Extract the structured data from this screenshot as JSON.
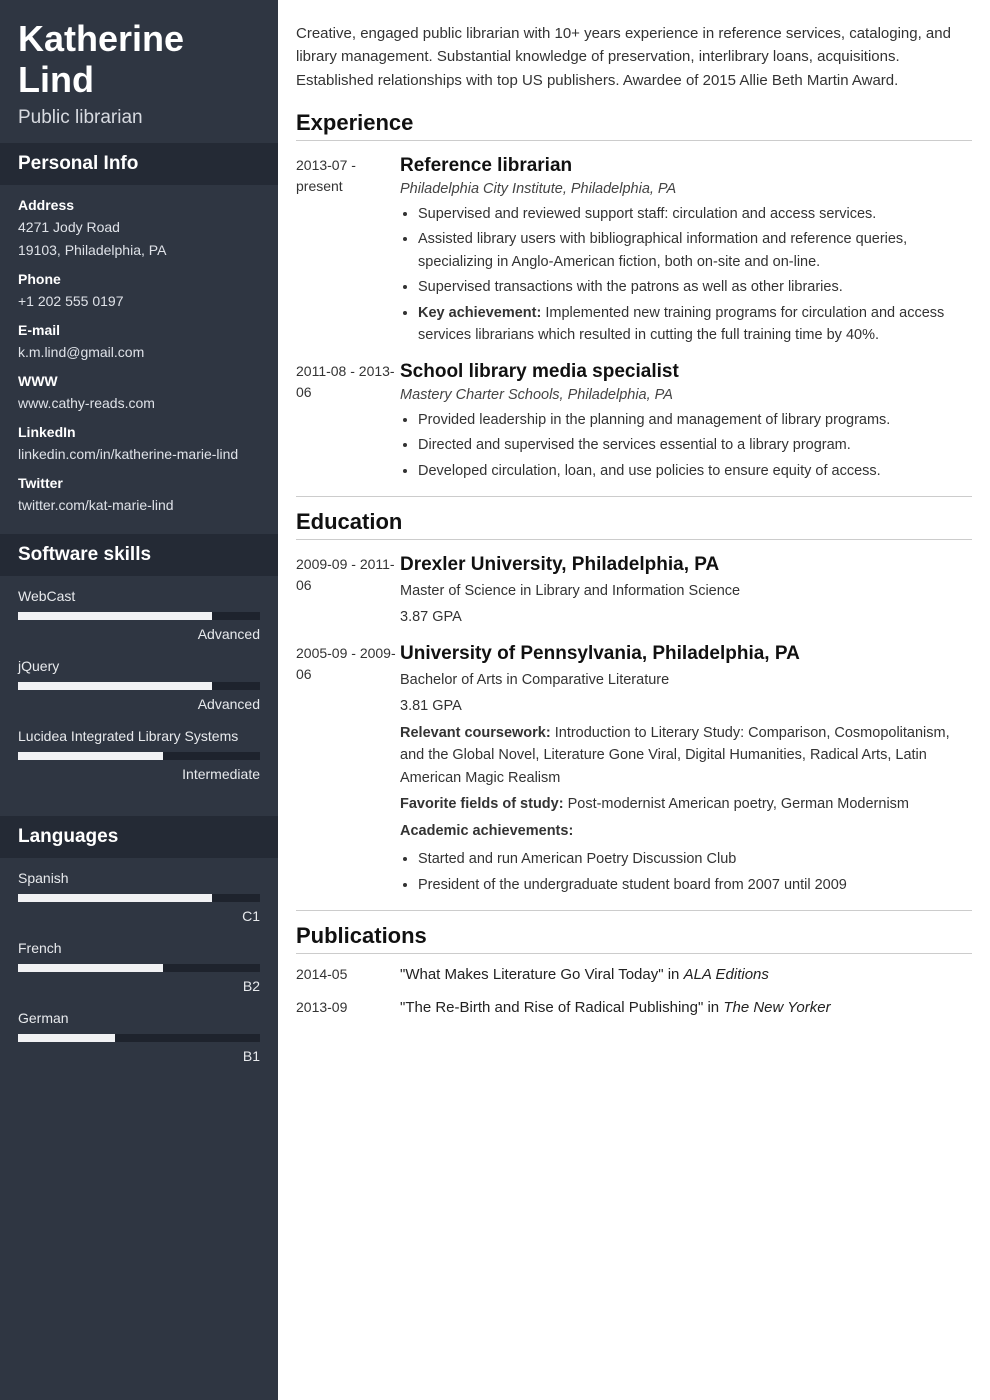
{
  "name": "Katherine Lind",
  "title": "Public librarian",
  "sidebar": {
    "personal_info_heading": "Personal Info",
    "info": {
      "address_label": "Address",
      "address_line1": "4271 Jody Road",
      "address_line2": "19103, Philadelphia, PA",
      "phone_label": "Phone",
      "phone_value": "+1 202 555 0197",
      "email_label": "E-mail",
      "email_value": "k.m.lind@gmail.com",
      "www_label": "WWW",
      "www_value": "www.cathy-reads.com",
      "linkedin_label": "LinkedIn",
      "linkedin_value": "linkedin.com/in/katherine-marie-lind",
      "twitter_label": "Twitter",
      "twitter_value": "twitter.com/kat-marie-lind"
    },
    "software_heading": "Software skills",
    "software": [
      {
        "name": "WebCast",
        "level": "Advanced",
        "pct": 80
      },
      {
        "name": "jQuery",
        "level": "Advanced",
        "pct": 80
      },
      {
        "name": "Lucidea Integrated Library Systems",
        "level": "Intermediate",
        "pct": 60
      }
    ],
    "languages_heading": "Languages",
    "languages": [
      {
        "name": "Spanish",
        "level": "C1",
        "pct": 80
      },
      {
        "name": "French",
        "level": "B2",
        "pct": 60
      },
      {
        "name": "German",
        "level": "B1",
        "pct": 40
      }
    ]
  },
  "summary": "Creative, engaged public librarian with 10+ years experience in reference services, cataloging, and library management. Substantial knowledge of preservation, interlibrary loans, acquisitions. Established relationships with top US publishers. Awardee of 2015 Allie Beth Martin Award.",
  "experience_heading": "Experience",
  "experience": [
    {
      "dates": "2013-07 - present",
      "title": "Reference librarian",
      "subtitle": "Philadelphia City Institute, Philadelphia, PA",
      "bullets": [
        "Supervised and reviewed support staff: circulation and access services.",
        "Assisted library users with bibliographical information and reference queries, specializing in Anglo-American fiction, both on-site and on-line.",
        "Supervised transactions with the patrons as well as other libraries."
      ],
      "key_label": "Key achievement:",
      "key_text": " Implemented new training programs for circulation and access services librarians which resulted in cutting the full training time by 40%."
    },
    {
      "dates": "2011-08 - 2013-06",
      "title": "School library media specialist",
      "subtitle": "Mastery Charter Schools, Philadelphia, PA",
      "bullets": [
        "Provided leadership in the planning and management of library programs.",
        "Directed and supervised the services essential to a library program.",
        "Developed circulation, loan, and use policies to ensure equity of access."
      ]
    }
  ],
  "education_heading": "Education",
  "education": [
    {
      "dates": "2009-09 - 2011-06",
      "title": "Drexler University, Philadelphia, PA",
      "degree": "Master of Science in Library and Information Science",
      "gpa": "3.87 GPA"
    },
    {
      "dates": "2005-09 - 2009-06",
      "title": "University of Pennsylvania, Philadelphia, PA",
      "degree": "Bachelor of Arts in Comparative Literature",
      "gpa": "3.81 GPA",
      "coursework_label": "Relevant coursework:",
      "coursework_text": " Introduction to Literary Study: Comparison, Cosmopolitanism, and the Global Novel, Literature Gone Viral, Digital Humanities, Radical Arts, Latin American Magic Realism",
      "favorites_label": "Favorite fields of study:",
      "favorites_text": " Post-modernist American poetry, German Modernism",
      "achievements_label": "Academic achievements:",
      "achievements": [
        "Started and run American Poetry Discussion Club",
        "President of the undergraduate student board from 2007 until 2009"
      ]
    }
  ],
  "publications_heading": "Publications",
  "publications": [
    {
      "date": "2014-05",
      "title": "\"What Makes Literature Go Viral Today\" in ",
      "venue": "ALA Editions"
    },
    {
      "date": "2013-09",
      "title": "\"The Re-Birth and Rise of Radical Publishing\" in ",
      "venue": "The New Yorker"
    }
  ]
}
